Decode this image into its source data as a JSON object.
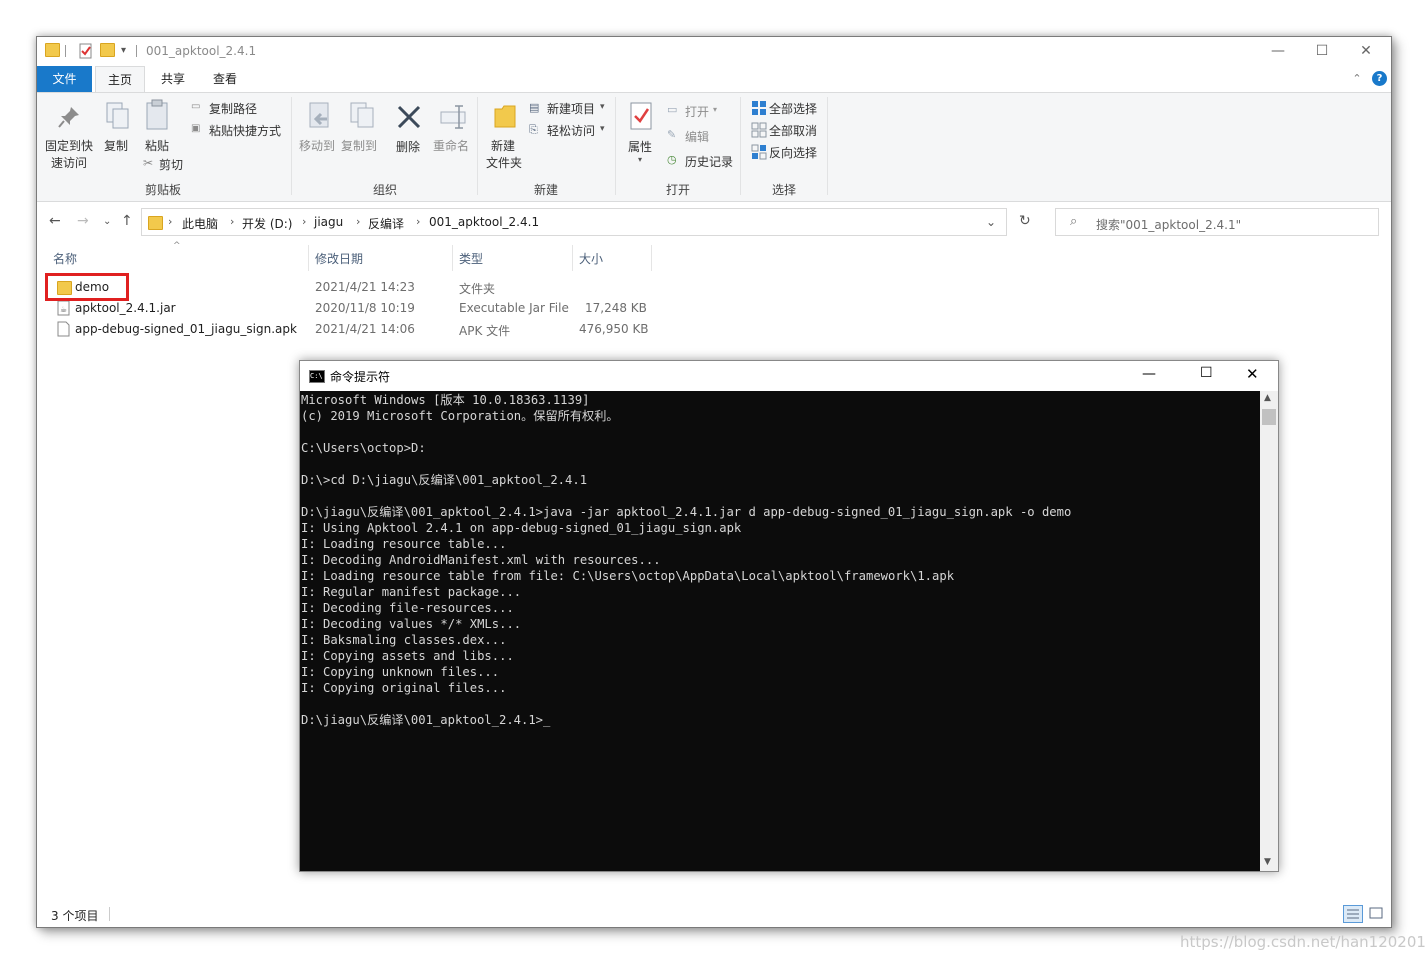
{
  "explorer": {
    "title": "001_apktool_2.4.1",
    "tabs": {
      "file": "文件",
      "home": "主页",
      "share": "共享",
      "view": "查看"
    },
    "ribbon": {
      "pin": "固定到快\n速访问",
      "pin_l1": "固定到快",
      "pin_l2": "速访问",
      "copy": "复制",
      "paste": "粘贴",
      "copy_path": "复制路径",
      "paste_shortcut": "粘贴快捷方式",
      "cut": "剪切",
      "clipboard_group": "剪贴板",
      "move_to": "移动到",
      "copy_to": "复制到",
      "delete": "删除",
      "rename": "重命名",
      "organize_group": "组织",
      "new_folder_l1": "新建",
      "new_folder_l2": "文件夹",
      "new_item": "新建项目",
      "easy_access": "轻松访问",
      "new_group": "新建",
      "properties": "属性",
      "open": "打开",
      "edit": "编辑",
      "history": "历史记录",
      "open_group": "打开",
      "select_all": "全部选择",
      "select_none": "全部取消",
      "invert_selection": "反向选择",
      "select_group": "选择"
    },
    "address": {
      "crumbs": [
        "此电脑",
        "开发 (D:)",
        "jiagu",
        "反编译",
        "001_apktool_2.4.1"
      ],
      "search_placeholder": "搜索\"001_apktool_2.4.1\""
    },
    "columns": {
      "name": "名称",
      "modified": "修改日期",
      "type": "类型",
      "size": "大小"
    },
    "files": [
      {
        "name": "demo",
        "modified": "2021/4/21 14:23",
        "type": "文件夹",
        "size": "",
        "icon": "folder-icon"
      },
      {
        "name": "apktool_2.4.1.jar",
        "modified": "2020/11/8 10:19",
        "type": "Executable Jar File",
        "size": "17,248 KB",
        "icon": "jar-file-icon"
      },
      {
        "name": "app-debug-signed_01_jiagu_sign.apk",
        "modified": "2021/4/21 14:06",
        "type": "APK 文件",
        "size": "476,950 KB",
        "icon": "file-icon"
      }
    ],
    "status": "3 个项目"
  },
  "cmd": {
    "title": "命令提示符",
    "lines": [
      "Microsoft Windows [版本 10.0.18363.1139]",
      "(c) 2019 Microsoft Corporation。保留所有权利。",
      "",
      "C:\\Users\\octop>D:",
      "",
      "D:\\>cd D:\\jiagu\\反编译\\001_apktool_2.4.1",
      "",
      "D:\\jiagu\\反编译\\001_apktool_2.4.1>java -jar apktool_2.4.1.jar d app-debug-signed_01_jiagu_sign.apk -o demo",
      "I: Using Apktool 2.4.1 on app-debug-signed_01_jiagu_sign.apk",
      "I: Loading resource table...",
      "I: Decoding AndroidManifest.xml with resources...",
      "I: Loading resource table from file: C:\\Users\\octop\\AppData\\Local\\apktool\\framework\\1.apk",
      "I: Regular manifest package...",
      "I: Decoding file-resources...",
      "I: Decoding values */* XMLs...",
      "I: Baksmaling classes.dex...",
      "I: Copying assets and libs...",
      "I: Copying unknown files...",
      "I: Copying original files...",
      "",
      "D:\\jiagu\\反编译\\001_apktool_2.4.1>_"
    ]
  },
  "watermark": "https://blog.csdn.net/han1202012",
  "colors": {
    "accent": "#1979ca",
    "highlight": "#e02020",
    "console_bg": "#0c0c0c"
  }
}
